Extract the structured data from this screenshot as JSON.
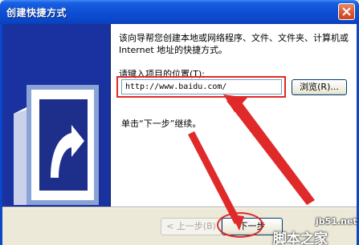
{
  "window": {
    "title": "创建快捷方式",
    "close_icon": "close-icon"
  },
  "wizard": {
    "intro": "该向导帮您创建本地或网络程序、文件、文件夹、计算机或 Internet 地址的快捷方式。",
    "location_label": "请键入项目的位置(T):",
    "location_value": "http://www.baidu.com/",
    "browse_label": "浏览(R)...",
    "next_hint": "单击“下一步”继续。"
  },
  "buttons": {
    "back_label": "< 上一步(B)",
    "next_label": "下一步"
  },
  "watermark": {
    "site": "jb51.net",
    "brand": "脚本之家"
  },
  "colors": {
    "titlebar": "#0f4fd4",
    "annotation": "#e02a2a",
    "side_panel": "#1a31a0"
  }
}
